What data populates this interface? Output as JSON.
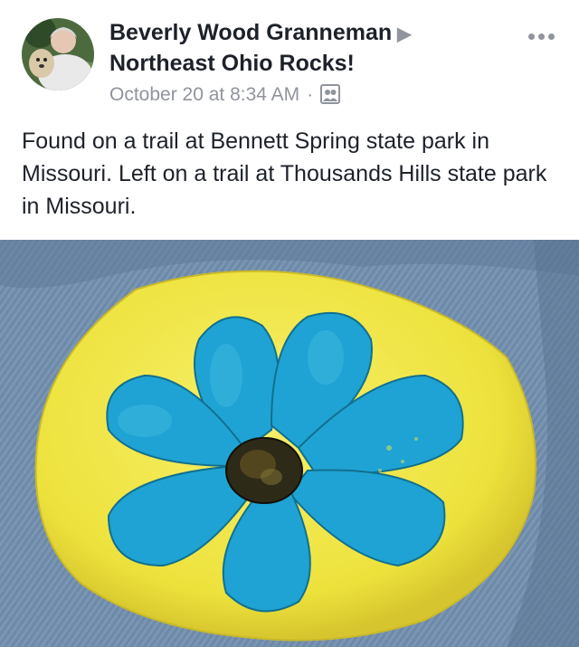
{
  "post": {
    "author": "Beverly Wood Granneman",
    "arrow": "▶",
    "group": "Northeast Ohio Rocks!",
    "timestamp": "October 20 at 8:34 AM",
    "separator": "·",
    "privacy_icon": "group-audience-icon",
    "more_icon": "more-options-icon",
    "body": "Found on a trail at Bennett Spring state park in Missouri.  Left on a trail at Thousands Hills state park in Missouri."
  },
  "photo": {
    "subject": "painted-rock-photo",
    "colors": {
      "denim": "#6d89a8",
      "rock_yellow": "#f2e84a",
      "petal_blue": "#1fa3d4",
      "center": "#2e2a18"
    }
  },
  "colors": {
    "text_primary": "#1d2129",
    "text_secondary": "#90949c"
  }
}
